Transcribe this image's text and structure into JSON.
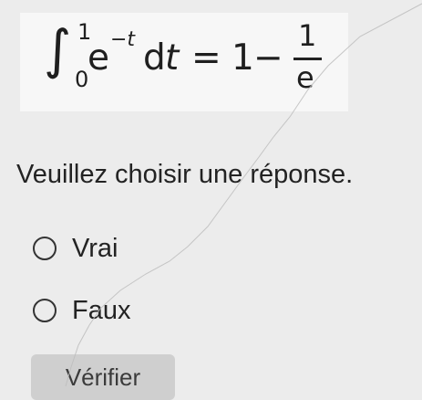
{
  "equation": {
    "integral_sign": "∫",
    "upper_limit": "1",
    "lower_limit": "0",
    "base": "e",
    "exponent": "−t",
    "differential_d": "d",
    "differential_var": "t",
    "equals": "=",
    "one": "1",
    "minus": "−",
    "fraction_numerator": "1",
    "fraction_denominator": "e"
  },
  "question": {
    "prompt": "Veuillez choisir une réponse."
  },
  "options": [
    {
      "label": "Vrai",
      "selected": false
    },
    {
      "label": "Faux",
      "selected": false
    }
  ],
  "verify_button": {
    "label": "Vérifier"
  },
  "colors": {
    "page_background": "#ececec",
    "equation_background": "#f7f7f7",
    "text": "#232323",
    "radio_border": "#333333",
    "button_background": "#cfcfcf"
  }
}
